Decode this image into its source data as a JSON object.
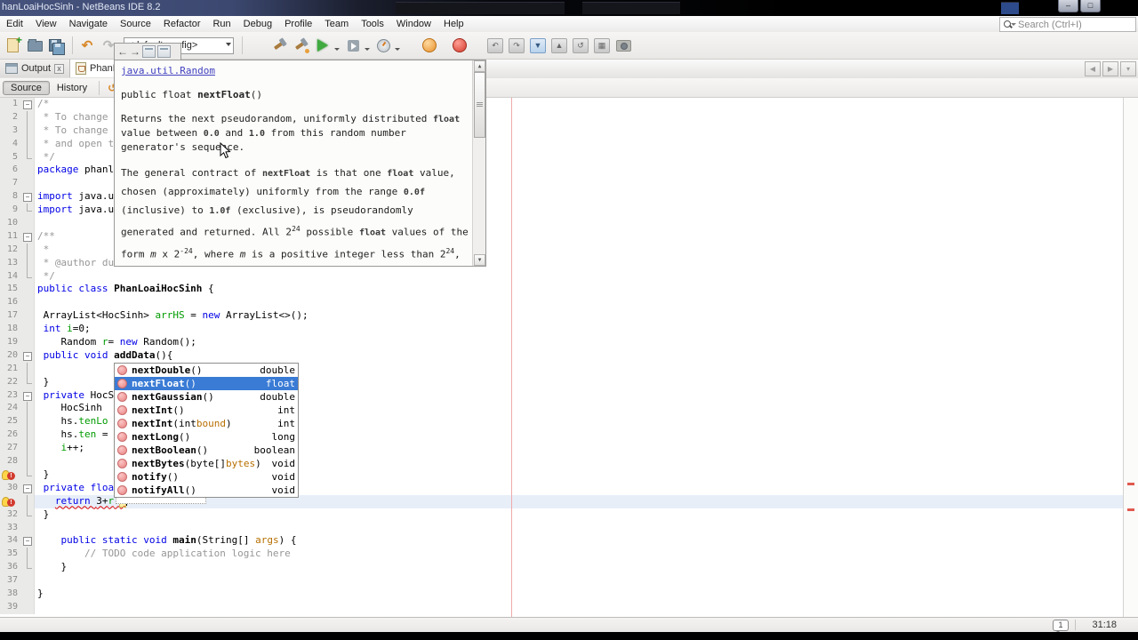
{
  "window": {
    "title": "hanLoaiHocSinh - NetBeans IDE 8.2"
  },
  "menubar": {
    "items": [
      "Edit",
      "View",
      "Navigate",
      "Source",
      "Refactor",
      "Run",
      "Debug",
      "Profile",
      "Team",
      "Tools",
      "Window",
      "Help"
    ]
  },
  "search": {
    "placeholder": "Search (Ctrl+I)"
  },
  "toolbar": {
    "config_value": "<default config>",
    "items": [
      {
        "kind": "icon",
        "name": "new-file"
      },
      {
        "kind": "icon",
        "name": "open-project"
      },
      {
        "kind": "icon",
        "name": "save-all"
      },
      {
        "kind": "sep"
      },
      {
        "kind": "icon",
        "name": "undo"
      },
      {
        "kind": "icon",
        "name": "redo"
      },
      {
        "kind": "combo",
        "name": "config-combo"
      },
      {
        "kind": "sep"
      },
      {
        "kind": "icon",
        "name": "build-project",
        "ml": 26
      },
      {
        "kind": "icon",
        "name": "clean-build-project"
      },
      {
        "kind": "icon",
        "name": "run-project",
        "dd": true
      },
      {
        "kind": "icon",
        "name": "debug-project",
        "dd": true
      },
      {
        "kind": "icon",
        "name": "profile-project",
        "dd": true
      },
      {
        "kind": "icon",
        "name": "profiler-pause",
        "ml": 18
      },
      {
        "kind": "icon",
        "name": "profiler-stop",
        "ml": 10
      },
      {
        "kind": "icon",
        "name": "profiler-rollback",
        "ml": 16
      },
      {
        "kind": "icon",
        "name": "profiler-modify"
      },
      {
        "kind": "icon",
        "name": "profiler-gc"
      },
      {
        "kind": "icon",
        "name": "profiler-dump"
      },
      {
        "kind": "icon",
        "name": "profiler-reset-results"
      },
      {
        "kind": "icon",
        "name": "profiler-threads"
      },
      {
        "kind": "icon",
        "name": "profiler-snapshot"
      }
    ]
  },
  "tabs": {
    "output_label": "Output",
    "output_close": "x",
    "editor_label": "PhanLoaiH"
  },
  "editor_toolbar": {
    "source_label": "Source",
    "history_label": "History"
  },
  "editor": {
    "lines": [
      {
        "n": 1,
        "fold": "start",
        "segs": [
          {
            "t": "/*",
            "c": "c"
          }
        ]
      },
      {
        "n": 2,
        "fold": "mid",
        "segs": [
          {
            "t": " * To change ",
            "c": "c"
          }
        ]
      },
      {
        "n": 3,
        "fold": "mid",
        "segs": [
          {
            "t": " * To change ",
            "c": "c"
          }
        ]
      },
      {
        "n": 4,
        "fold": "mid",
        "segs": [
          {
            "t": " * and open t",
            "c": "c"
          }
        ]
      },
      {
        "n": 5,
        "fold": "end",
        "segs": [
          {
            "t": " */",
            "c": "c"
          }
        ]
      },
      {
        "n": 6,
        "segs": [
          {
            "t": "package ",
            "c": "k"
          },
          {
            "t": "phanl",
            "c": "t"
          }
        ]
      },
      {
        "n": 7,
        "segs": []
      },
      {
        "n": 8,
        "fold": "start",
        "segs": [
          {
            "t": "import ",
            "c": "k"
          },
          {
            "t": "java.u",
            "c": "t"
          }
        ]
      },
      {
        "n": 9,
        "fold": "end",
        "segs": [
          {
            "t": "import ",
            "c": "k"
          },
          {
            "t": "java.u",
            "c": "t"
          }
        ]
      },
      {
        "n": 10,
        "segs": []
      },
      {
        "n": 11,
        "fold": "start",
        "segs": [
          {
            "t": "/**",
            "c": "c"
          }
        ]
      },
      {
        "n": 12,
        "fold": "mid",
        "segs": [
          {
            "t": " *",
            "c": "c"
          }
        ]
      },
      {
        "n": 13,
        "fold": "mid",
        "segs": [
          {
            "t": " * @author du",
            "c": "c"
          }
        ]
      },
      {
        "n": 14,
        "fold": "end",
        "segs": [
          {
            "t": " */",
            "c": "c"
          }
        ]
      },
      {
        "n": 15,
        "segs": [
          {
            "t": "public class ",
            "c": "k"
          },
          {
            "t": "PhanLoaiHocSinh",
            "c": "m"
          },
          {
            "t": " {",
            "c": "t"
          }
        ]
      },
      {
        "n": 16,
        "segs": []
      },
      {
        "n": 17,
        "segs": [
          {
            "t": " ArrayList<HocSinh> ",
            "c": "t"
          },
          {
            "t": "arrHS",
            "c": "f"
          },
          {
            "t": " = ",
            "c": "t"
          },
          {
            "t": "new ",
            "c": "k"
          },
          {
            "t": "ArrayList<>();",
            "c": "t"
          }
        ]
      },
      {
        "n": 18,
        "segs": [
          {
            "t": " ",
            "c": "t"
          },
          {
            "t": "int ",
            "c": "k"
          },
          {
            "t": "i",
            "c": "f"
          },
          {
            "t": "=0;",
            "c": "t"
          }
        ]
      },
      {
        "n": 19,
        "segs": [
          {
            "t": "    Random ",
            "c": "t"
          },
          {
            "t": "r",
            "c": "f"
          },
          {
            "t": "= ",
            "c": "t"
          },
          {
            "t": "new ",
            "c": "k"
          },
          {
            "t": "Random();",
            "c": "t"
          }
        ]
      },
      {
        "n": 20,
        "fold": "start",
        "segs": [
          {
            "t": " ",
            "c": "t"
          },
          {
            "t": "public void ",
            "c": "k"
          },
          {
            "t": "addData",
            "c": "m"
          },
          {
            "t": "(){",
            "c": "t"
          }
        ]
      },
      {
        "n": 21,
        "fold": "mid",
        "segs": []
      },
      {
        "n": 22,
        "fold": "end",
        "segs": [
          {
            "t": " }",
            "c": "t"
          }
        ]
      },
      {
        "n": 23,
        "fold": "start",
        "segs": [
          {
            "t": " ",
            "c": "t"
          },
          {
            "t": "private ",
            "c": "k"
          },
          {
            "t": "HocS",
            "c": "t"
          }
        ]
      },
      {
        "n": 24,
        "fold": "mid",
        "segs": [
          {
            "t": "    HocSinh ",
            "c": "t"
          }
        ]
      },
      {
        "n": 25,
        "fold": "mid",
        "segs": [
          {
            "t": "    hs.",
            "c": "t"
          },
          {
            "t": "tenLo",
            "c": "f"
          }
        ]
      },
      {
        "n": 26,
        "fold": "mid",
        "segs": [
          {
            "t": "    hs.",
            "c": "t"
          },
          {
            "t": "ten",
            "c": "f"
          },
          {
            "t": " = ",
            "c": "t"
          }
        ]
      },
      {
        "n": 27,
        "fold": "mid",
        "segs": [
          {
            "t": "    ",
            "c": "t"
          },
          {
            "t": "i",
            "c": "f"
          },
          {
            "t": "++;",
            "c": "t"
          }
        ]
      },
      {
        "n": 28,
        "fold": "mid",
        "segs": []
      },
      {
        "n": 29,
        "fold": "end",
        "badge": "error",
        "segs": [
          {
            "t": " }",
            "c": "t"
          }
        ]
      },
      {
        "n": 30,
        "fold": "start",
        "segs": [
          {
            "t": " ",
            "c": "t"
          },
          {
            "t": "private floa",
            "c": "k"
          }
        ]
      },
      {
        "n": 31,
        "fold": "mid",
        "badge": "error",
        "current": true,
        "caret": true,
        "segs": [
          {
            "t": "   ",
            "c": "t"
          },
          {
            "t": "return ",
            "c": "k",
            "e": 1
          },
          {
            "t": "3+",
            "c": "t",
            "e": 1
          },
          {
            "t": "r",
            "c": "f",
            "e": 1
          },
          {
            "t": ".",
            "c": "t",
            "e": 1
          },
          {
            "t": "n",
            "c": "t",
            "e": 1,
            "box": 1
          }
        ]
      },
      {
        "n": 32,
        "fold": "end",
        "segs": [
          {
            "t": " }",
            "c": "t"
          }
        ]
      },
      {
        "n": 33,
        "segs": []
      },
      {
        "n": 34,
        "fold": "start",
        "segs": [
          {
            "t": "    ",
            "c": "t"
          },
          {
            "t": "public static void ",
            "c": "k"
          },
          {
            "t": "main",
            "c": "m"
          },
          {
            "t": "(String[] ",
            "c": "t"
          },
          {
            "t": "args",
            "c": "p"
          },
          {
            "t": ") {",
            "c": "t"
          }
        ]
      },
      {
        "n": 35,
        "fold": "mid",
        "segs": [
          {
            "t": "        // TODO code application logic here",
            "c": "c"
          }
        ]
      },
      {
        "n": 36,
        "fold": "end",
        "segs": [
          {
            "t": "    }",
            "c": "t"
          }
        ]
      },
      {
        "n": 37,
        "segs": []
      },
      {
        "n": 38,
        "segs": [
          {
            "t": "}",
            "c": "t"
          }
        ]
      },
      {
        "n": 39,
        "segs": []
      }
    ]
  },
  "javadoc_popup": {
    "paragraphs": [
      {
        "type": "link",
        "segs": [
          {
            "t": "java.util.Random",
            "s": "link"
          }
        ]
      },
      {
        "type": "sig",
        "segs": [
          {
            "t": "public float ",
            "s": "plain"
          },
          {
            "t": "nextFloat",
            "s": "bold"
          },
          {
            "t": "()",
            "s": "plain"
          }
        ]
      },
      {
        "type": "body",
        "segs": [
          {
            "t": "Returns the next pseudorandom, uniformly distributed ",
            "s": "plain"
          },
          {
            "t": "float",
            "s": "code"
          },
          {
            "t": " value between ",
            "s": "plain"
          },
          {
            "t": "0.0",
            "s": "code"
          },
          {
            "t": " and ",
            "s": "plain"
          },
          {
            "t": "1.0",
            "s": "code"
          },
          {
            "t": " from this random number generator's sequence.",
            "s": "plain"
          }
        ]
      },
      {
        "type": "body3",
        "segs": [
          {
            "t": "The general contract of ",
            "s": "plain"
          },
          {
            "t": "nextFloat",
            "s": "code"
          },
          {
            "t": " is that one ",
            "s": "plain"
          },
          {
            "t": "float",
            "s": "code"
          },
          {
            "t": " value, chosen (approximately) uniformly from the range ",
            "s": "plain"
          },
          {
            "t": "0.0f",
            "s": "code"
          },
          {
            "t": " (inclusive) to ",
            "s": "plain"
          },
          {
            "t": "1.0f",
            "s": "code"
          },
          {
            "t": " (exclusive), is pseudorandomly generated and returned. All 2",
            "s": "plain"
          },
          {
            "t": "24",
            "s": "sup"
          },
          {
            "t": " possible ",
            "s": "plain"
          },
          {
            "t": "float",
            "s": "code"
          },
          {
            "t": " values of the form ",
            "s": "plain"
          },
          {
            "t": "m",
            "s": "i"
          },
          {
            "t": " x 2",
            "s": "plain"
          },
          {
            "t": "-24",
            "s": "sup"
          },
          {
            "t": ", where ",
            "s": "plain"
          },
          {
            "t": "m",
            "s": "i"
          },
          {
            "t": " is a positive integer less than 2",
            "s": "plain"
          },
          {
            "t": "24",
            "s": "sup"
          },
          {
            "t": ", are produced with (approximately) equal probability.",
            "s": "plain"
          }
        ]
      }
    ]
  },
  "completion": {
    "items": [
      {
        "name": "nextDouble",
        "params": [
          {
            "t": "()"
          }
        ],
        "type": "double"
      },
      {
        "name": "nextFloat",
        "params": [
          {
            "t": "()"
          }
        ],
        "type": "float",
        "selected": true
      },
      {
        "name": "nextGaussian",
        "params": [
          {
            "t": "()"
          }
        ],
        "type": "double"
      },
      {
        "name": "nextInt",
        "params": [
          {
            "t": "()"
          }
        ],
        "type": "int"
      },
      {
        "name": "nextInt",
        "params": [
          {
            "t": "(int "
          },
          {
            "t": "bound",
            "p": 1
          },
          {
            "t": ")"
          }
        ],
        "type": "int"
      },
      {
        "name": "nextLong",
        "params": [
          {
            "t": "()"
          }
        ],
        "type": "long"
      },
      {
        "name": "nextBoolean",
        "params": [
          {
            "t": "()"
          }
        ],
        "type": "boolean"
      },
      {
        "name": "nextBytes",
        "params": [
          {
            "t": "(byte[] "
          },
          {
            "t": "bytes",
            "p": 1
          },
          {
            "t": ")"
          }
        ],
        "type": "void"
      },
      {
        "name": "notify",
        "params": [
          {
            "t": "()"
          }
        ],
        "type": "void"
      },
      {
        "name": "notifyAll",
        "params": [
          {
            "t": "()"
          }
        ],
        "type": "void"
      }
    ]
  },
  "statusbar": {
    "notification_count": "1",
    "caret_position": "31:18"
  },
  "colors": {
    "keyword": "#0000e6",
    "comment": "#969696",
    "field": "#009b00",
    "param": "#b76f00",
    "selection_bg": "#3a7bd5",
    "error": "#e00000",
    "link": "#4040c0",
    "margin_line": "#efa9a9",
    "current_line_bg": "#e7eef8"
  }
}
